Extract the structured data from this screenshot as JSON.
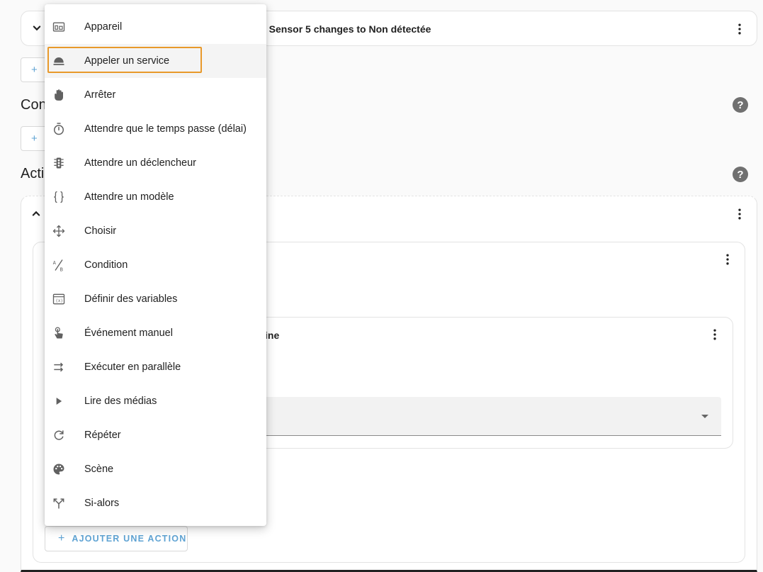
{
  "triggers": {
    "card_title": "e Sensor 5 changes to Non détectée",
    "add_icon": "+"
  },
  "conditions": {
    "title": "Con",
    "add_icon": "+"
  },
  "actions": {
    "title": "Acti",
    "inner_title": "ine",
    "add_action": {
      "icon": "+",
      "label": "AJOUTER UNE ACTION"
    }
  },
  "help_icon": "?",
  "menu": {
    "highlight_color": "#e8992b",
    "items": [
      {
        "icon": "device-icon",
        "label": "Appareil"
      },
      {
        "icon": "service-bell-icon",
        "label": "Appeler un service"
      },
      {
        "icon": "hand-stop-icon",
        "label": "Arrêter"
      },
      {
        "icon": "timer-icon",
        "label": "Attendre que le temps passe (délai)"
      },
      {
        "icon": "traffic-light-icon",
        "label": "Attendre un déclencheur"
      },
      {
        "icon": "code-braces-icon",
        "label": "Attendre un modèle"
      },
      {
        "icon": "arrows-all-icon",
        "label": "Choisir"
      },
      {
        "icon": "condition-ab-icon",
        "label": "Condition"
      },
      {
        "icon": "variable-box-icon",
        "label": "Définir des variables"
      },
      {
        "icon": "gesture-tap-icon",
        "label": "Événement manuel"
      },
      {
        "icon": "parallel-arrows-icon",
        "label": "Exécuter en parallèle"
      },
      {
        "icon": "play-icon",
        "label": "Lire des médias"
      },
      {
        "icon": "refresh-icon",
        "label": "Répéter"
      },
      {
        "icon": "palette-icon",
        "label": "Scène"
      },
      {
        "icon": "call-split-icon",
        "label": "Si-alors"
      }
    ]
  }
}
